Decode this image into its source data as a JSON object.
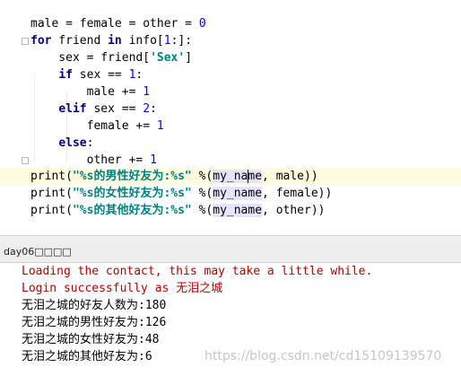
{
  "editor": {
    "l1": {
      "a": "male = female = other = ",
      "n": "0"
    },
    "l2": {
      "k1": "for",
      "a": " friend ",
      "k2": "in",
      "b": " info[",
      "n": "1",
      "c": ":]:"
    },
    "l3": {
      "a": "    sex = friend[",
      "s": "'Sex'",
      "b": "]"
    },
    "l4": {
      "pre": "    ",
      "k": "if",
      "a": " sex == ",
      "n": "1",
      "b": ":"
    },
    "l5": {
      "a": "        male += ",
      "n": "1"
    },
    "l6": {
      "pre": "    ",
      "k": "elif",
      "a": " sex == ",
      "n": "2",
      "b": ":"
    },
    "l7": {
      "a": "        female += ",
      "n": "1"
    },
    "l8": {
      "pre": "    ",
      "k": "else",
      "b": ":"
    },
    "l9": {
      "a": "        other += ",
      "n": "1"
    },
    "p1": {
      "fn": "print(",
      "s": "\"%s的男性好友为:%s\"",
      "a": " %(",
      "v1": "my_na",
      "v2": "me",
      "b": ", male))"
    },
    "p2": {
      "fn": "print(",
      "s": "\"%s的女性好友为:%s\"",
      "a": " %(",
      "v": "my_name",
      "b": ", female))"
    },
    "p3": {
      "fn": "print(",
      "s": "\"%s的其他好友为:%s\"",
      "a": " %(",
      "v": "my_name",
      "b": ", other))"
    }
  },
  "run_tab": {
    "label": "day06□□□□"
  },
  "console": {
    "lines": [
      "Loading the contact, this may take a little while.",
      "Login successfully as 无泪之城",
      "无泪之城的好友人数为:180",
      "无泪之城的男性好友为:126",
      "无泪之城的女性好友为:48",
      "无泪之城的其他好友为:6"
    ],
    "watermark": "https://blog.csdn.net/cd15109139570"
  },
  "colors": {
    "keyword": "#000080",
    "number": "#0000ff",
    "string": "#008080",
    "console_info": "#b40000",
    "current_line": "#fffbdf"
  }
}
